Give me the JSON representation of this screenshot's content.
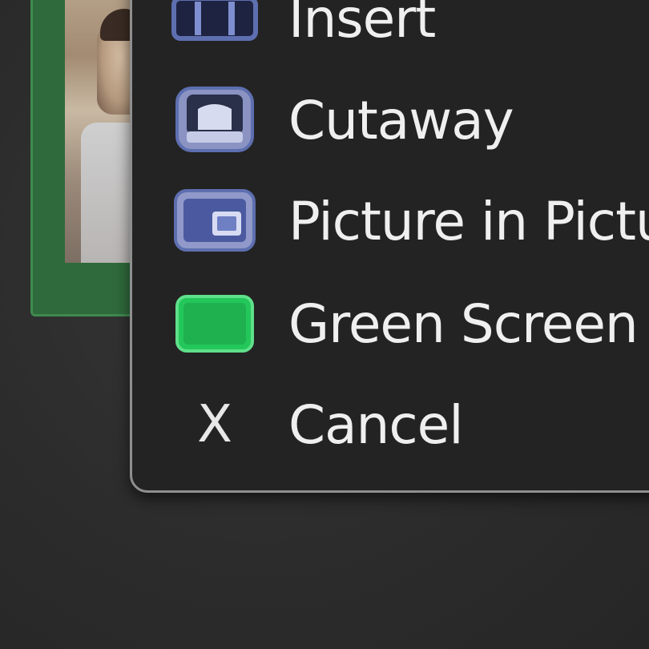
{
  "menu": {
    "items": [
      {
        "label": "Insert",
        "icon": "insert-icon"
      },
      {
        "label": "Cutaway",
        "icon": "cutaway-icon"
      },
      {
        "label": "Picture in Pictu",
        "icon": "picture-in-picture-icon"
      },
      {
        "label": "Green Screen",
        "icon": "green-screen-icon"
      },
      {
        "label": "Cancel",
        "icon": "close-icon",
        "glyph": "X"
      }
    ]
  },
  "colors": {
    "background": "#2d2d2d",
    "menu_background": "#232323",
    "menu_border": "#8f8f8f",
    "icon_blue": "#5e6fb0",
    "green_screen": "#23c75a",
    "clip_frame": "#3f8a4e"
  }
}
